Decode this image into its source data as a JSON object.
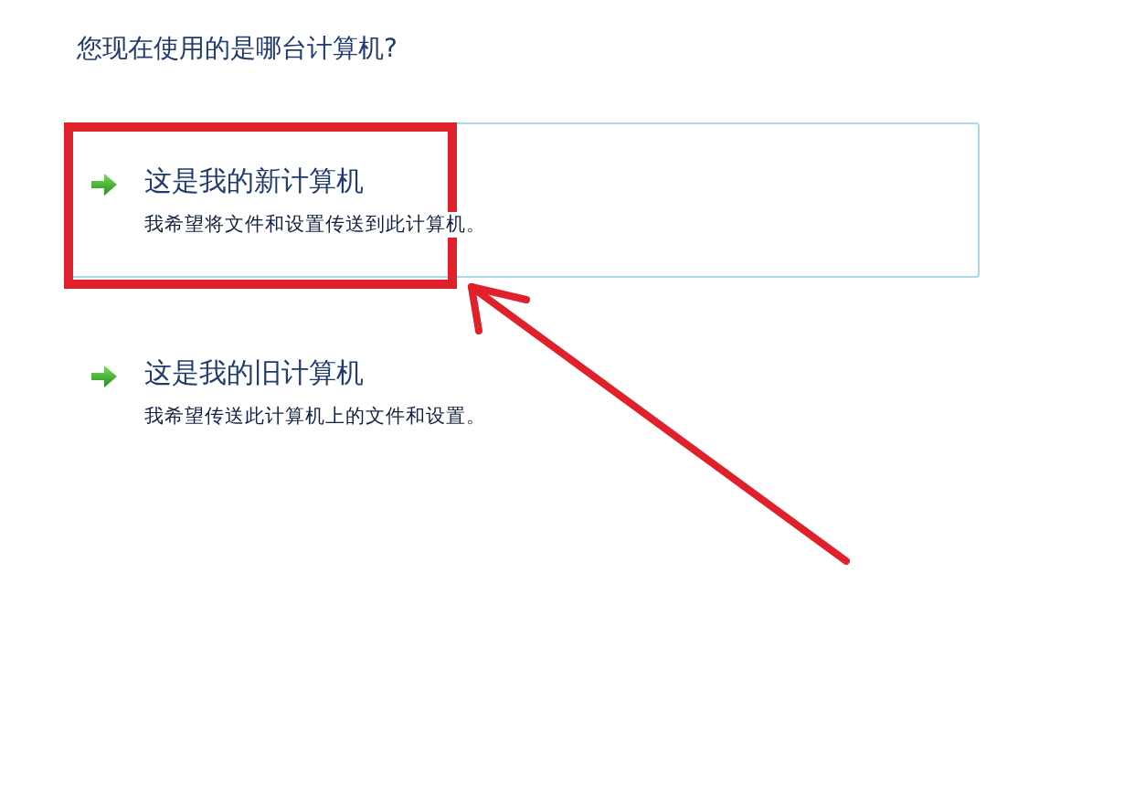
{
  "heading": "您现在使用的是哪台计算机?",
  "options": [
    {
      "title": "这是我的新计算机",
      "description": "我希望将文件和设置传送到此计算机。",
      "highlighted": true
    },
    {
      "title": "这是我的旧计算机",
      "description": "我希望传送此计算机上的文件和设置。",
      "highlighted": false
    }
  ],
  "annotation": {
    "highlight_box": true,
    "arrow": true
  }
}
